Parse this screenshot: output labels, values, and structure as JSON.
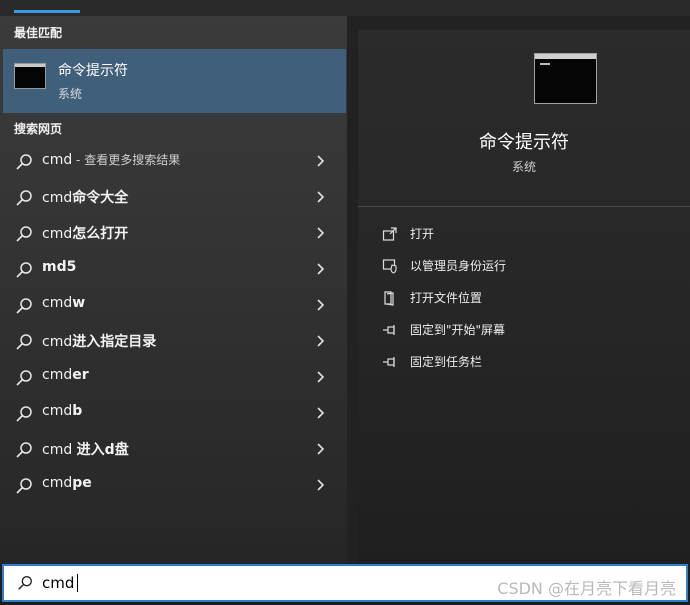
{
  "best_match": {
    "heading": "最佳匹配",
    "app_name": "命令提示符",
    "app_type": "系统",
    "icon": "command-prompt-icon"
  },
  "web": {
    "heading": "搜索网页",
    "items": [
      {
        "query": "cmd",
        "bold": "",
        "suffix": " - 查看更多搜索结果"
      },
      {
        "query": "cmd",
        "bold": "命令大全",
        "suffix": ""
      },
      {
        "query": "cmd",
        "bold": "怎么打开",
        "suffix": ""
      },
      {
        "query": "",
        "bold": "md5",
        "suffix": ""
      },
      {
        "query": "cmd",
        "bold": "w",
        "suffix": ""
      },
      {
        "query": "cmd",
        "bold": "进入指定目录",
        "suffix": ""
      },
      {
        "query": "cmd",
        "bold": "er",
        "suffix": ""
      },
      {
        "query": "cmd",
        "bold": "b",
        "suffix": ""
      },
      {
        "query": "cmd ",
        "bold": "进入d盘",
        "suffix": ""
      },
      {
        "query": "cmd",
        "bold": "pe",
        "suffix": ""
      }
    ]
  },
  "details": {
    "app_name": "命令提示符",
    "app_type": "系统",
    "actions": [
      {
        "label": "打开",
        "icon": "open-icon"
      },
      {
        "label": "以管理员身份运行",
        "icon": "shield-icon"
      },
      {
        "label": "打开文件位置",
        "icon": "folder-location-icon"
      },
      {
        "label": "固定到\"开始\"屏幕",
        "icon": "pin-icon"
      },
      {
        "label": "固定到任务栏",
        "icon": "pin-icon"
      }
    ]
  },
  "search": {
    "value": "cmd",
    "icon": "search-icon"
  },
  "watermark": "CSDN @在月亮下看月亮",
  "colors": {
    "selection": "#3f5f7b",
    "accent": "#2f7fd1",
    "tab_indicator": "#3a9be3"
  }
}
